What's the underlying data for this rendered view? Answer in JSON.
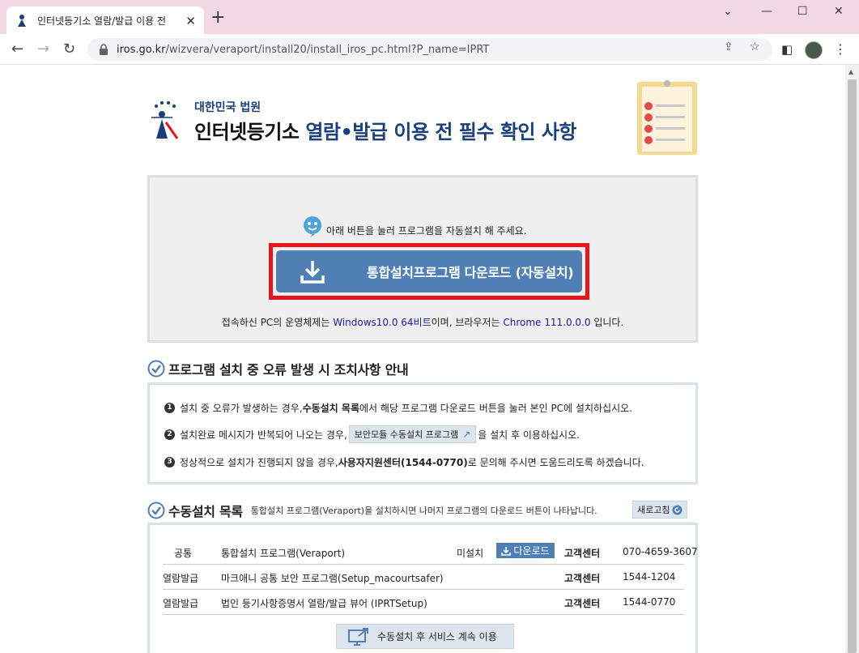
{
  "browser": {
    "tab_title": "인터넷등기소 열람/발급 이용 전",
    "url_host": "iros.go.kr",
    "url_path": "/wizvera/veraport/install20/install_iros_pc.html?P_name=IPRT"
  },
  "header": {
    "org": "대한민국 법원",
    "title_dark": "인터넷등기소",
    "title_blue": "열람•발급 이용 전 필수 확인 사항"
  },
  "download": {
    "hint": "아래 버튼을 눌러 프로그램을 자동설치 해 주세요.",
    "button_label": "통합설치프로그램 다운로드 (자동설치)",
    "sys_prefix": "접속하신 PC의 운영체제는 ",
    "sys_os": "Windows10.0 64비트",
    "sys_mid": "이며, 브라우저는 ",
    "sys_browser": "Chrome 111.0.0.0",
    "sys_suffix": " 입니다."
  },
  "errors": {
    "heading": "프로그램 설치 중 오류 발생 시 조치사항 안내",
    "items": [
      {
        "num": "1",
        "pre": "설치 중 오류가 발생하는 경우, ",
        "bold": "수동설치 목록",
        "post": "에서 해당 프로그램 다운로드 버튼을 눌러 본인 PC에 설치하십시오."
      },
      {
        "num": "2",
        "pre": "설치완료 메시지가 반복되어 나오는 경우, ",
        "button": "보안모듈 수동설치 프로그램",
        "post": "을 설치 후 이용하십시오."
      },
      {
        "num": "3",
        "pre": "정상적으로 설치가 진행되지 않을 경우, ",
        "bold": "사용자지원센터(1544-0770)",
        "post": "로 문의해 주시면 도움드리도록 하겠습니다."
      }
    ]
  },
  "manual": {
    "heading": "수동설치 목록",
    "sub": "통합설치 프로그램(Veraport)을 설치하시면 나머지 프로그램의 다운로드 버튼이 나타납니다.",
    "refresh_label": "새로고침",
    "rows": [
      {
        "cat": "공통",
        "name": "통합설치 프로그램(Veraport)",
        "status": "미설치",
        "dl": "다운로드",
        "cc": "고객센터",
        "tel": "070-4659-3607"
      },
      {
        "cat": "열람발급",
        "name": "마크애니 공통 보안 프로그램(Setup_macourtsafer)",
        "cc": "고객센터",
        "tel": "1544-1204"
      },
      {
        "cat": "열람발급",
        "name": "법인 등기사항증명서 열람/발급 뷰어 (IPRTSetup)",
        "cc": "고객센터",
        "tel": "1544-0770"
      }
    ],
    "continue_label": "수동설치 후 서비스 계속 이용"
  },
  "colors": {
    "accent": "#4f7fb4",
    "highlight_frame": "#e8141b",
    "title_blue": "#1a3f7a"
  }
}
